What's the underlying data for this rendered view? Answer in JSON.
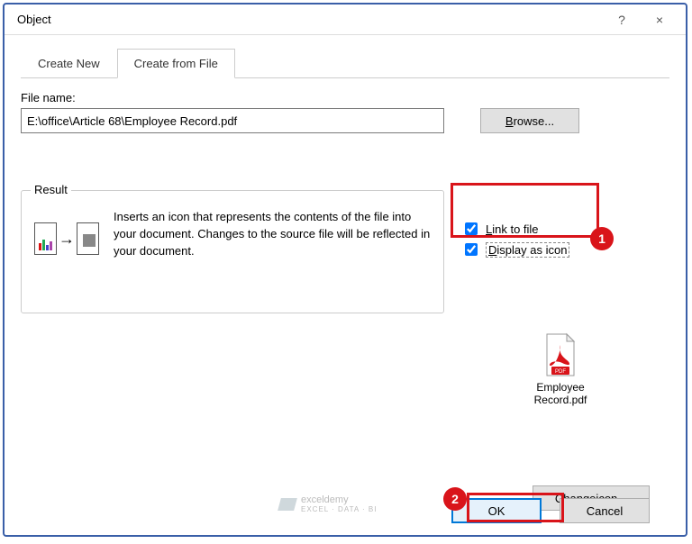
{
  "dialog": {
    "title": "Object",
    "help_icon": "?",
    "close_icon": "×"
  },
  "tabs": {
    "create_new": "Create New",
    "create_from_file": "Create from File"
  },
  "file": {
    "label": "File name:",
    "value": "E:\\office\\Article 68\\Employee Record.pdf",
    "browse_prefix": "B",
    "browse_rest": "rowse..."
  },
  "checks": {
    "link_prefix": "L",
    "link_rest": "ink to file",
    "display_prefix": "D",
    "display_rest": "isplay as icon"
  },
  "result": {
    "legend": "Result",
    "text": "Inserts an icon that represents the contents of the file into your document. Changes to the source file will be reflected in your document."
  },
  "pdf": {
    "name_line1": "Employee",
    "name_line2": "Record.pdf",
    "badge": "PDF"
  },
  "change_icon": {
    "prefix": "Change ",
    "accel": "i",
    "suffix": "con..."
  },
  "buttons": {
    "ok": "OK",
    "cancel": "Cancel"
  },
  "annotations": {
    "n1": "1",
    "n2": "2"
  },
  "watermark": {
    "top": "exceldemy",
    "sub": "EXCEL · DATA · BI"
  }
}
